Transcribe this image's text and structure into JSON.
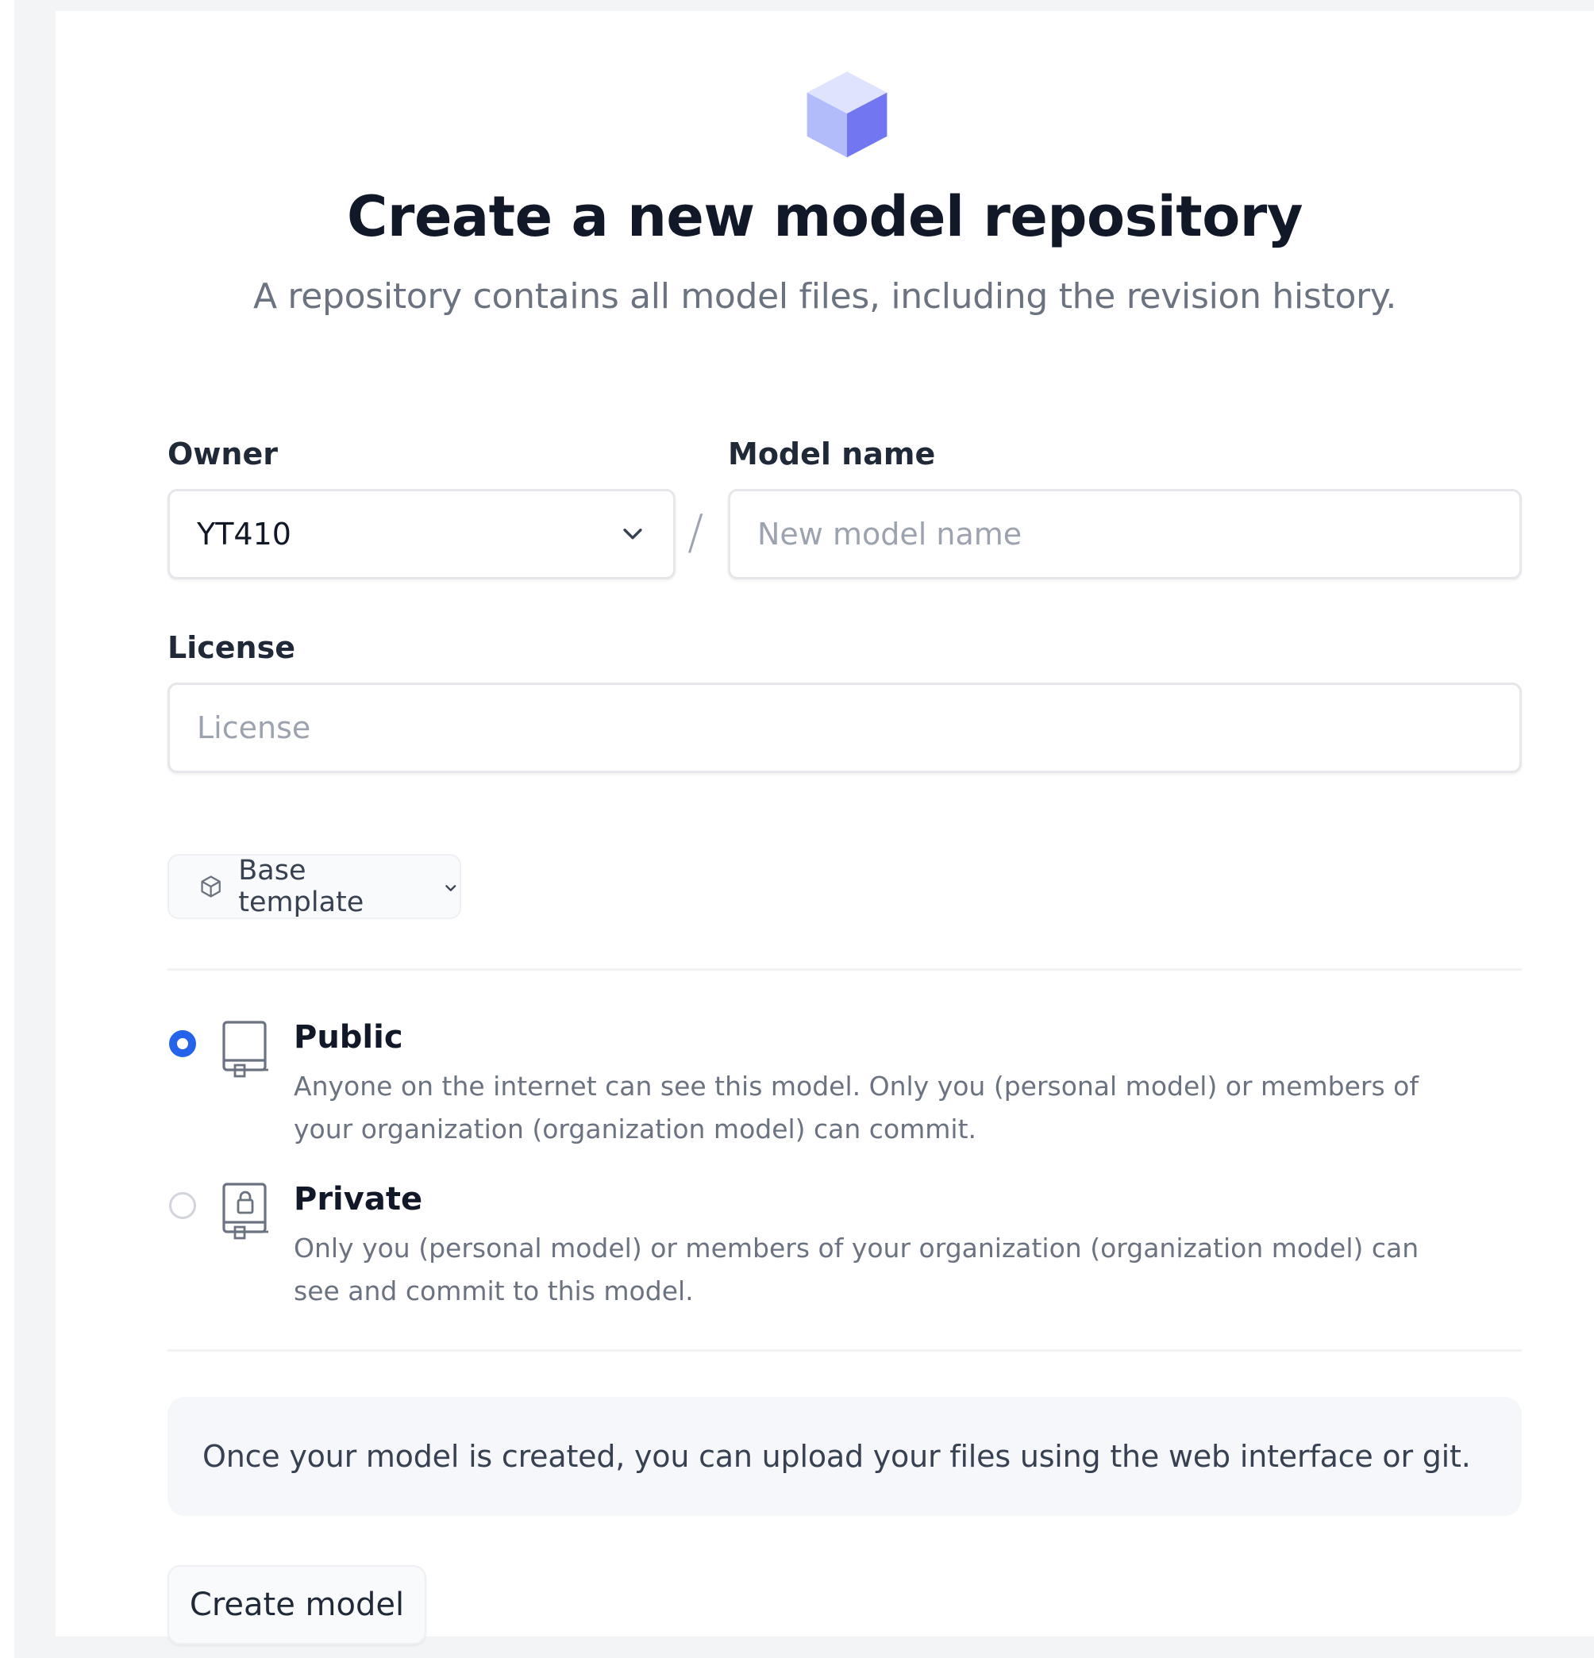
{
  "header": {
    "logo_icon": "cube-icon",
    "title": "Create a new model repository",
    "subtitle": "A repository contains all model files, including the revision history."
  },
  "form": {
    "owner_label": "Owner",
    "owner_value": "YT410",
    "separator": "/",
    "model_name_label": "Model name",
    "model_name_placeholder": "New model name",
    "license_label": "License",
    "license_placeholder": "License",
    "template_button_label": "Base template"
  },
  "visibility": {
    "selected": "public",
    "options": [
      {
        "id": "public",
        "title": "Public",
        "description": "Anyone on the internet can see this model. Only you (personal model) or members of your organization (organization model) can commit.",
        "icon": "repo-icon",
        "checked": true
      },
      {
        "id": "private",
        "title": "Private",
        "description": "Only you (personal model) or members of your organization (organization model) can see and commit to this model.",
        "icon": "repo-lock-icon",
        "checked": false
      }
    ]
  },
  "info": {
    "text": "Once your model is created, you can upload your files using the web interface or git."
  },
  "actions": {
    "create_label": "Create model"
  },
  "colors": {
    "accent": "#2563eb",
    "logo_light": "#c7d2fe",
    "logo_mid": "#a5b4fc",
    "logo_dark": "#6366f1"
  }
}
